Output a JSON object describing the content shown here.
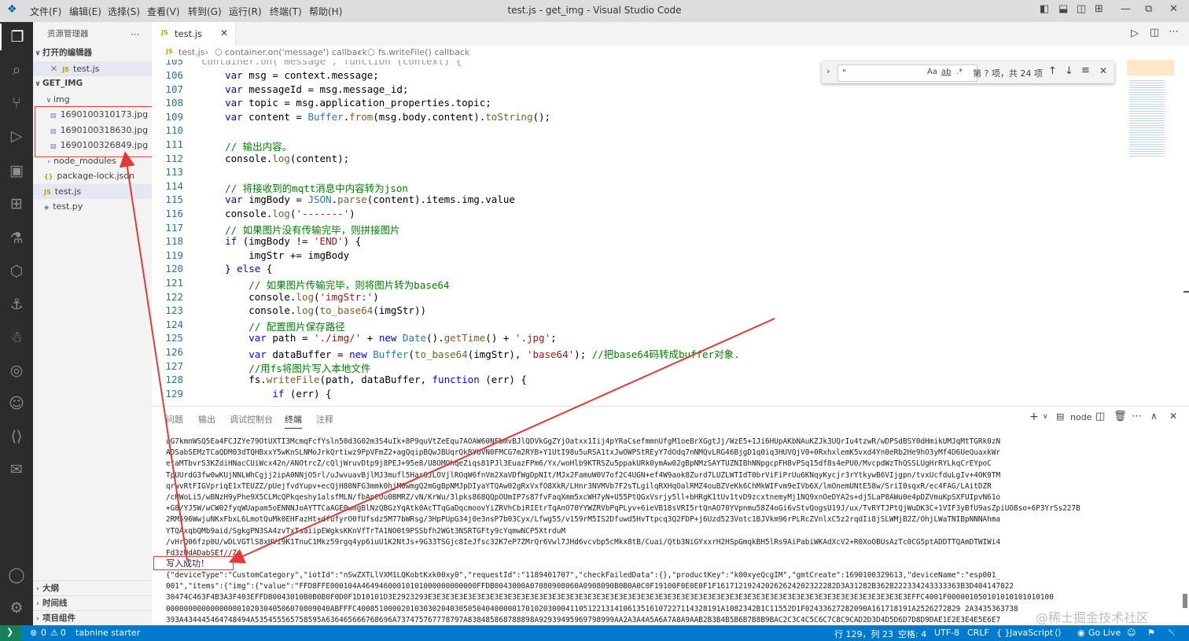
{
  "titlebar": {
    "menus": [
      "文件(F)",
      "编辑(E)",
      "选择(S)",
      "查看(V)",
      "转到(G)",
      "运行(R)",
      "终端(T)",
      "帮助(H)"
    ],
    "title": "test.js - get_img - Visual Studio Code"
  },
  "sidebar": {
    "header": "资源管理器",
    "open_editors": "打开的编辑器",
    "open_file": "test.js",
    "project": "GET_IMG",
    "folder_img": "img",
    "images": [
      "1690100310173.jpg",
      "1690100318630.jpg",
      "1690100326849.jpg"
    ],
    "files": [
      "node_modules",
      "package-lock.json",
      "test.js",
      "test.py"
    ],
    "outline": "大纲",
    "timeline": "时间线",
    "project_section": "项目组件"
  },
  "editor": {
    "tab": "test.js",
    "breadcrumb": [
      "test.js",
      "container.on('message') callback",
      "fs.writeFile() callback"
    ],
    "find": {
      "value": "\"",
      "result": "第 ? 项，共 24 项",
      "opts": [
        "Aa",
        "ab",
        ".*"
      ]
    },
    "top_partial": "container.on( message , function (context) {",
    "lines": [
      {
        "n": "106",
        "text": "    var msg = context.message;"
      },
      {
        "n": "107",
        "text": "    var messageId = msg.message_id;"
      },
      {
        "n": "108",
        "text": "    var topic = msg.application_properties.topic;"
      },
      {
        "n": "109",
        "text": "    var content = Buffer.from(msg.body.content).toString();"
      },
      {
        "n": "110",
        "text": ""
      },
      {
        "n": "111",
        "text": "    // 输出内容。"
      },
      {
        "n": "112",
        "text": "    console.log(content);"
      },
      {
        "n": "113",
        "text": ""
      },
      {
        "n": "114",
        "text": "    // 将接收到的mqtt消息中内容转为json"
      },
      {
        "n": "115",
        "text": "    var imgBody = JSON.parse(content).items.img.value"
      },
      {
        "n": "116",
        "text": "    console.log('-------')"
      },
      {
        "n": "117",
        "text": "    // 如果图片没有传输完毕，则拼接图片"
      },
      {
        "n": "118",
        "text": "    if (imgBody != 'END') {"
      },
      {
        "n": "119",
        "text": "        imgStr += imgBody"
      },
      {
        "n": "120",
        "text": "    } else {"
      },
      {
        "n": "121",
        "text": "        // 如果图片传输完毕，则将图片转为base64"
      },
      {
        "n": "122",
        "text": "        console.log('imgStr:')"
      },
      {
        "n": "123",
        "text": "        console.log(to_base64(imgStr))"
      },
      {
        "n": "124",
        "text": "        // 配置图片保存路径"
      },
      {
        "n": "125",
        "text": "        var path = './img/' + new Date().getTime() + '.jpg';"
      },
      {
        "n": "126",
        "text": "        var dataBuffer = new Buffer(to_base64(imgStr), 'base64'); //把base64码转成buffer对象."
      },
      {
        "n": "127",
        "text": "        //用fs将图片写入本地文件"
      },
      {
        "n": "128",
        "text": "        fs.writeFile(path, dataBuffer, function (err) {"
      },
      {
        "n": "129",
        "text": "            if (err) {"
      }
    ]
  },
  "panel": {
    "tabs": [
      "问题",
      "输出",
      "调试控制台",
      "终端",
      "注释"
    ],
    "active_tab": "终端",
    "terminal_name": "node",
    "lines": [
      "uG7kmnWSQ5Ea4FCJZYe79OtUXTI3McmqFcfYsln50d3G02m3S4uIk+8P9quVtZeEqu7AOAW60NFbmvBJlQDVkGgZYjOatxx1Iij4pYRaCsefmmnUfgM1oeBrXGgtJj/WzE5+1Ji6HUpAKbNAuKZJk3UQrIu4tzwR/wDPSdBSY0dHmikUMJqMtTGRk0zN",
      "ADSabSEMzTCaQDM03dTQHBxxY5wKnSLNMoJrkQrtiwz9PpVFmZ2+agQqipBQwJBUqrQkBYUVN0FMCG7m2RYB+Y1UtI98u5uRSA1txJwOWPStREyY7dOdq7nNMQvLRG46BjgD1q0iq3HUVQjV0+0RxhxlemK5vxd4Yn0eRb2He9hO3yMf4D6UeQuaxkWr",
      "etaMTbvrS3KZdiHNacCUiWcx42n/ANOtrcZ/cQljWruvDtp9j8PEJ+95e8/U8OMOhqeZiqs81PJl3EuazFPm6/Yx/woHlb9KTRSZu5ppakURk0ymAw02gBpNMzSAYTUZNIBhNNpgcpFH8vPSq15df8s4ePU0/MvcpdWzThQSSLUgHrRYLkqCrEYpoC",
      "TpUUrdG3fw0wKUjNNLWhCgjj2ipA0NNjO5rl/uJwvuavBjlMJ3mufl5HarSJLOVjlROqW6fnVm2XaVDfWgDpNIt/MJx2FamuW0V7of2C4UGN+ef4W9aok8Zurd7LUZLWTIdT0brViFiPrUu6KNqyKycjr3rYtkywB6VIjgpn/tvxUcfduLgIv+4OK9TM",
      "qrwvRtFIGVpriqE1xTEUZZ/pUejfvdYupv+ecQjH80NFG3mmk0hjM0wmgQ2mGgBpNMJpDIyaYTQAw02gRxVxfO8XkR/LHnr3NVMVb7F2sTLgilqRXHqOalRMZ4ouBZVeKk6ChMkWIFvm9eIVb6X/lmOnemUNtE58w/SriI0sqxR/ec4FAG/LAitDZR",
      "/cHWoLi5/wBNzH9yPhe9X5CLMcQPkqeshy1alsfMLN/fbApCOu0BMRZ/vN/KrWu/3lpks868QQpOUmIP7s87fvFaqXmm5xcWH7yN+U55PtQGxVsrjy5ll+bHRgK1tUv1tvD9zcxtnemyMj1NQ9xnOeDYA2s+dj5LaP8AWu0e4pDZVmuKpSXFUIpvN61o",
      "+G8/YJ5W/wCW02fyqWUapam5oENNNJoAYTTCaAGE0wmgBlNzQBGzYqAtk0AcTTqGaDqcmoovYiZRVhCbiRIEtrTqAnO70YYWZRVbPqPLyv+6ieVB18sVRI5rtQnAO70YVpnmu58Z4oGi6vStvQogsU19J/ux/TvRYTJPtQjWuDK3C+1VIF3yBfU9asZpiUO8so+6P3YrSs227B",
      "2RM596WwjuNKxFbxL6LmotQuMk0EHFazHt+dfufyrO0fUfsdz5M77bWRsg/3HpPUpG34j0e3nsP7b03Cyx/Lfwg55/v159rM5IS2Dfuwd5HvTtpcq3Q2FDP+j6Uzd523Votc1BJVkm96rPLRcZVnlxC5z2rqdIi8jSLWMjB2Z/OhjLWaTNIBpNNNAhma",
      "YTQAxqbQMb9aid/SgkgPN3SA4zvTxTsaiipEWgksKKnVfTrTA1NO0t9PSSbfh2WGt3NSRTGFty9cYqmwNCP5XtrduM",
      "/vHrQ06fzp0U/wDLVGTlS8xHVi9K1TnuC1Mkz59rgq4yp6iuU1K2NtJs+9G33TSGjc8IeJfsc32K7eP7ZMrQr6Vwl7JHd6vcvbp5cMkx8tB/Cuai/Qtb3NiGYxxrH2HSpGmqkBH5lRs9AiPabiWKAdXcV2+R0XoOBUsAzTc0CG5ptADDTTQAmDTWIWi4",
      "Fd3zUdADabSEf//Z"
    ],
    "success_msg": "写入成功！",
    "json_lines": [
      "{\"deviceType\":\"CustomCategory\",\"iotId\":\"nSwZXTLlVXM1LQKobtKxk00xy0\",\"requestId\":\"1189401707\",\"checkFailedData\":{},\"productKey\":\"k00xyeQcgIM\",\"gmtCreate\":1690100329613,\"deviceName\":\"esp001_",
      "001\",\"items\":{\"img\":{\"value\":\"FFD8FFE000104A46494600010101000000000000FFDB0043000A07080908060A0908090B0B0A0C0F19100F0E0E0F1F161712192420262624202322282D3A31282B362B222334243333363B3D404147022",
      "30474C463F4B3A3F403EFFDB0043010B0B0B0F0D0F1D10101D3E2923293E3E3E3E3E3E3E3E3E3E3E3E3E3E3E3E3E3E3E3E3E3E3E3E3E3E3E3E3E3E3E3E3E3E3E3E3E3E3E3E3E3E3E3E3E3E3E3E3E3E3E3E3E3E3EFFC4001F000001050101010101010100",
      "0000000000000000010203040506070809040ABFFFC4008510000201030302040305050404000001701020300041105122131410613516107227114328191A1082342B1C11552D1F02433627282090A161718191A2526272829 2A3435363738",
      "393A434445464748494A535455565758595A636465666768696A737475767778797A838485868788898A92939495969798999AA2A3A4A5A6A7A8A9AAB2B3B4B5B6B7B8B9BAC2C3C4C5C6C7C8C9CAD2D3D4D5D6D7D8D9DAE1E2E3E4E5E6E7"
    ],
    "watermark": "@稀土掘金技术社区"
  },
  "statusbar": {
    "errors": "0",
    "warnings": "0",
    "extension": "tabnine starter",
    "position": "行 129，列 23",
    "spaces": "空格: 4",
    "encoding": "UTF-8",
    "eol": "CRLF",
    "language": "JavaScript",
    "golive": "Go Live"
  }
}
